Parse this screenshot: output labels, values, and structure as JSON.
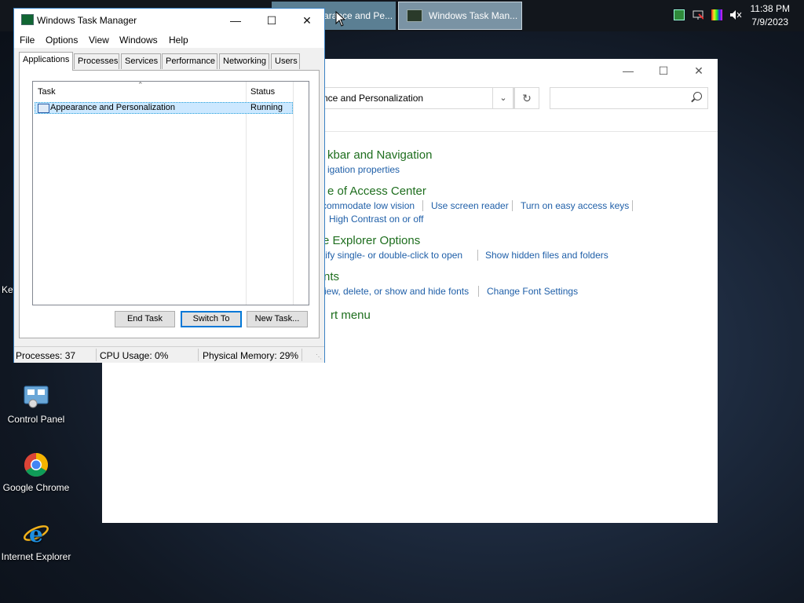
{
  "taskbar": {
    "buttons": [
      {
        "label": "Appearance and Pe..."
      },
      {
        "label": "Windows Task Man..."
      }
    ],
    "clock": {
      "time": "11:38 PM",
      "date": "7/9/2023"
    },
    "tray_icons": [
      "app-icon",
      "network-icon",
      "color-icon",
      "volume-muted-icon"
    ]
  },
  "desktop": {
    "icons": [
      {
        "label": "Control Panel"
      },
      {
        "label": "Google Chrome"
      },
      {
        "label": "Internet Explorer"
      }
    ],
    "partial_left_label": "Key"
  },
  "control_panel": {
    "address_text": "nce and Personalization",
    "categories": [
      {
        "title": "kbar and Navigation",
        "links": [
          "igation properties"
        ]
      },
      {
        "title": "e of Access Center",
        "links": [
          "commodate low vision",
          "Use screen reader",
          "Turn on easy access keys",
          "High Contrast on or off"
        ]
      },
      {
        "title": "e Explorer Options",
        "links": [
          "tify single- or double-click to open",
          "Show hidden files and folders"
        ]
      },
      {
        "title": "nts",
        "links": [
          "iew, delete, or show and hide fonts",
          "Change Font Settings"
        ]
      },
      {
        "title": "rt menu",
        "links": []
      }
    ]
  },
  "task_manager": {
    "title": "Windows Task Manager",
    "menu": [
      "File",
      "Options",
      "View",
      "Windows",
      "Help"
    ],
    "tabs": [
      "Applications",
      "Processes",
      "Services",
      "Performance",
      "Networking",
      "Users"
    ],
    "active_tab": "Applications",
    "columns": [
      "Task",
      "Status"
    ],
    "rows": [
      {
        "task": "Appearance and Personalization",
        "status": "Running"
      }
    ],
    "buttons": [
      "End Task",
      "Switch To",
      "New Task..."
    ],
    "status": {
      "processes": "Processes: 37",
      "cpu": "CPU Usage: 0%",
      "memory": "Physical Memory: 29%"
    }
  }
}
